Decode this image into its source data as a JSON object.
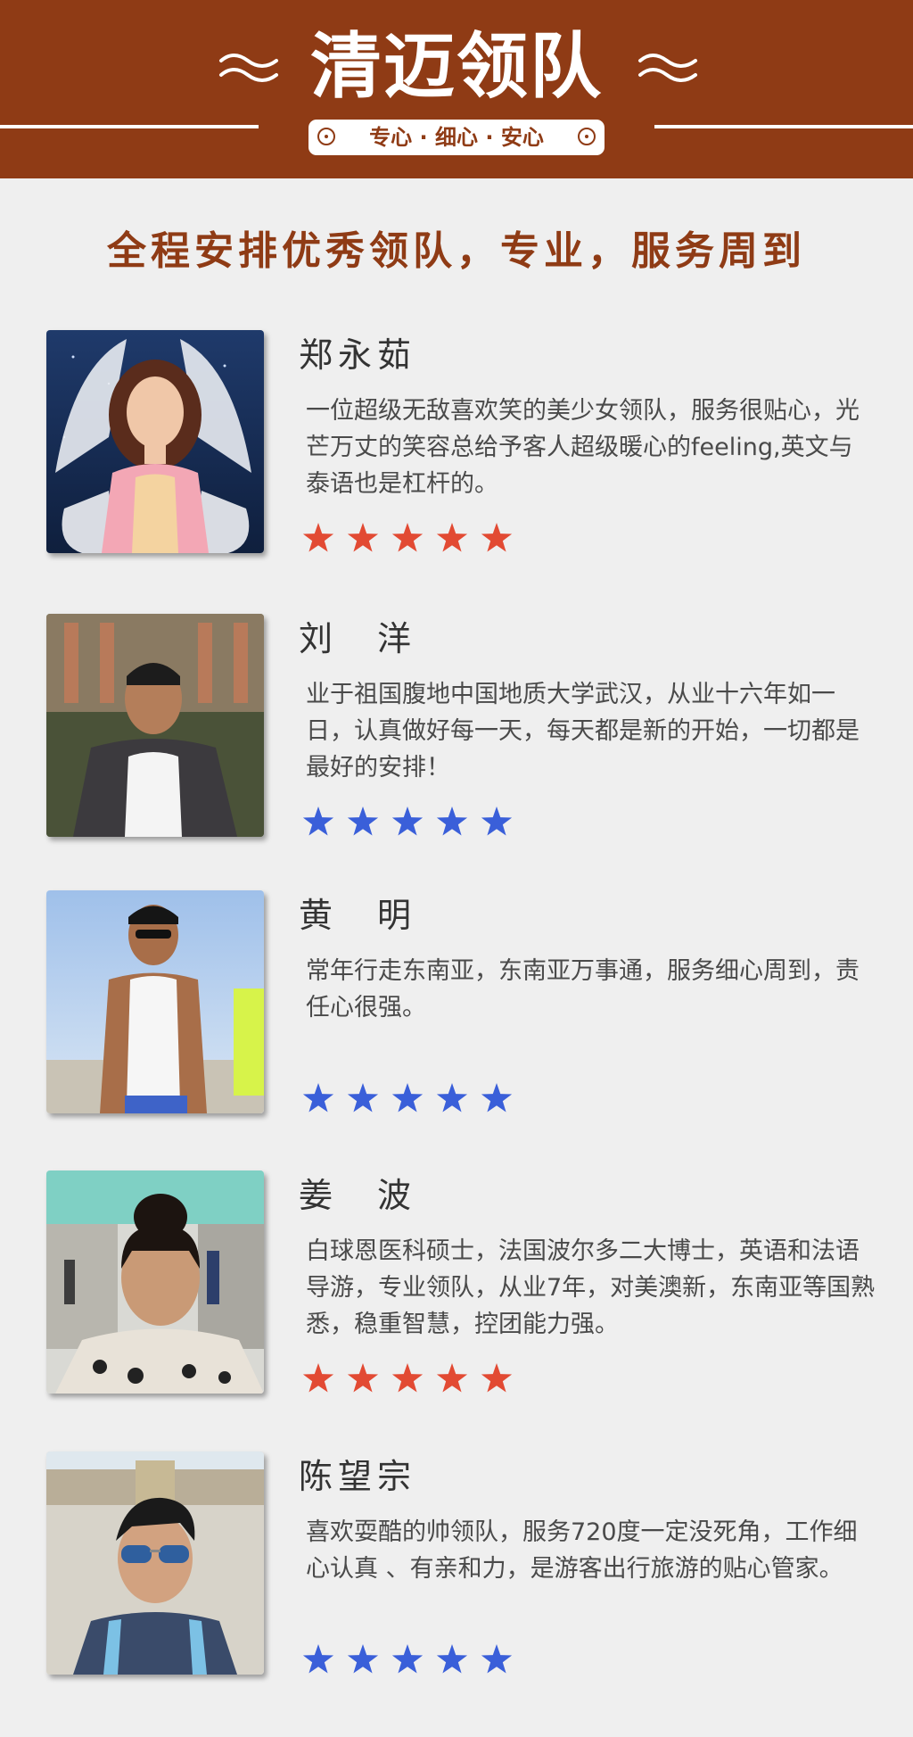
{
  "header": {
    "title": "清迈领队",
    "slogan": "专心 · 细心 · 安心",
    "background_color": "#8f3b15"
  },
  "subtitle": "全程安排优秀领队，专业，服务周到",
  "leaders": [
    {
      "name": "郑永茹",
      "description": "一位超级无敌喜欢笑的美少女领队，服务很贴心，光芒万丈的笑容总给予客人超级暖心的feeling,英文与泰语也是杠杆的。",
      "rating": 5,
      "star_color": "#e24a33",
      "photo_icon": "portrait-photo-angel-wings"
    },
    {
      "name": "刘　洋",
      "description": "业于祖国腹地中国地质大学武汉，从业十六年如一日，认真做好每一天，每天都是新的开始，一切都是最好的安排！",
      "rating": 5,
      "star_color": "#3a5fd9",
      "photo_icon": "portrait-photo-palace-lake"
    },
    {
      "name": "黄　明",
      "description": "常年行走东南亚，东南亚万事通，服务细心周到，责任心很强。",
      "rating": 5,
      "star_color": "#3a5fd9",
      "photo_icon": "portrait-photo-beach"
    },
    {
      "name": "姜　波",
      "description": "白球恩医科硕士，法国波尔多二大博士，英语和法语导游，专业领队，从业7年，对美澳新，东南亚等国熟悉，稳重智慧，控团能力强。",
      "rating": 5,
      "star_color": "#e24a33",
      "photo_icon": "portrait-photo-street-selfie"
    },
    {
      "name": "陈望宗",
      "description": "喜欢耍酷的帅领队，服务720度一定没死角，工作细心认真 、有亲和力，是游客出行旅游的贴心管家。",
      "rating": 5,
      "star_color": "#3a5fd9",
      "photo_icon": "portrait-photo-sunglasses-plaza"
    }
  ]
}
